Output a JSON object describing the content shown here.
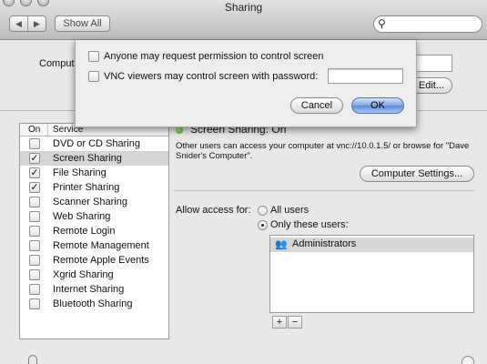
{
  "window": {
    "title": "Sharing"
  },
  "toolbar": {
    "back": "◀",
    "forward": "▶",
    "show_all": "Show All",
    "search_placeholder": ""
  },
  "computer": {
    "name_label": "Computer",
    "edit_button": "Edit..."
  },
  "services": {
    "header_on": "On",
    "header_service": "Service",
    "items": [
      {
        "label": "DVD or CD Sharing",
        "checked": false,
        "selected": false
      },
      {
        "label": "Screen Sharing",
        "checked": true,
        "selected": true
      },
      {
        "label": "File Sharing",
        "checked": true,
        "selected": false
      },
      {
        "label": "Printer Sharing",
        "checked": true,
        "selected": false
      },
      {
        "label": "Scanner Sharing",
        "checked": false,
        "selected": false
      },
      {
        "label": "Web Sharing",
        "checked": false,
        "selected": false
      },
      {
        "label": "Remote Login",
        "checked": false,
        "selected": false
      },
      {
        "label": "Remote Management",
        "checked": false,
        "selected": false
      },
      {
        "label": "Remote Apple Events",
        "checked": false,
        "selected": false
      },
      {
        "label": "Xgrid Sharing",
        "checked": false,
        "selected": false
      },
      {
        "label": "Internet Sharing",
        "checked": false,
        "selected": false
      },
      {
        "label": "Bluetooth Sharing",
        "checked": false,
        "selected": false
      }
    ]
  },
  "detail": {
    "status": "Screen Sharing: On",
    "status_color": "#3b9a1a",
    "description": "Other users can access your computer at vnc://10.0.1.5/ or browse for \"Dave Snider's Computer\".",
    "computer_settings_button": "Computer Settings...",
    "access_label": "Allow access for:",
    "all_users": "All users",
    "only_these_users": "Only these users:",
    "selected_access": "only_these_users",
    "users": [
      "Administrators"
    ],
    "add_button": "+",
    "remove_button": "−"
  },
  "sheet": {
    "option_request": "Anyone may request permission to control screen",
    "option_vnc": "VNC viewers may control screen with password:",
    "option_request_checked": false,
    "option_vnc_checked": false,
    "password_value": "",
    "cancel_button": "Cancel",
    "ok_button": "OK",
    "accent_color": "#5a8ad9"
  }
}
